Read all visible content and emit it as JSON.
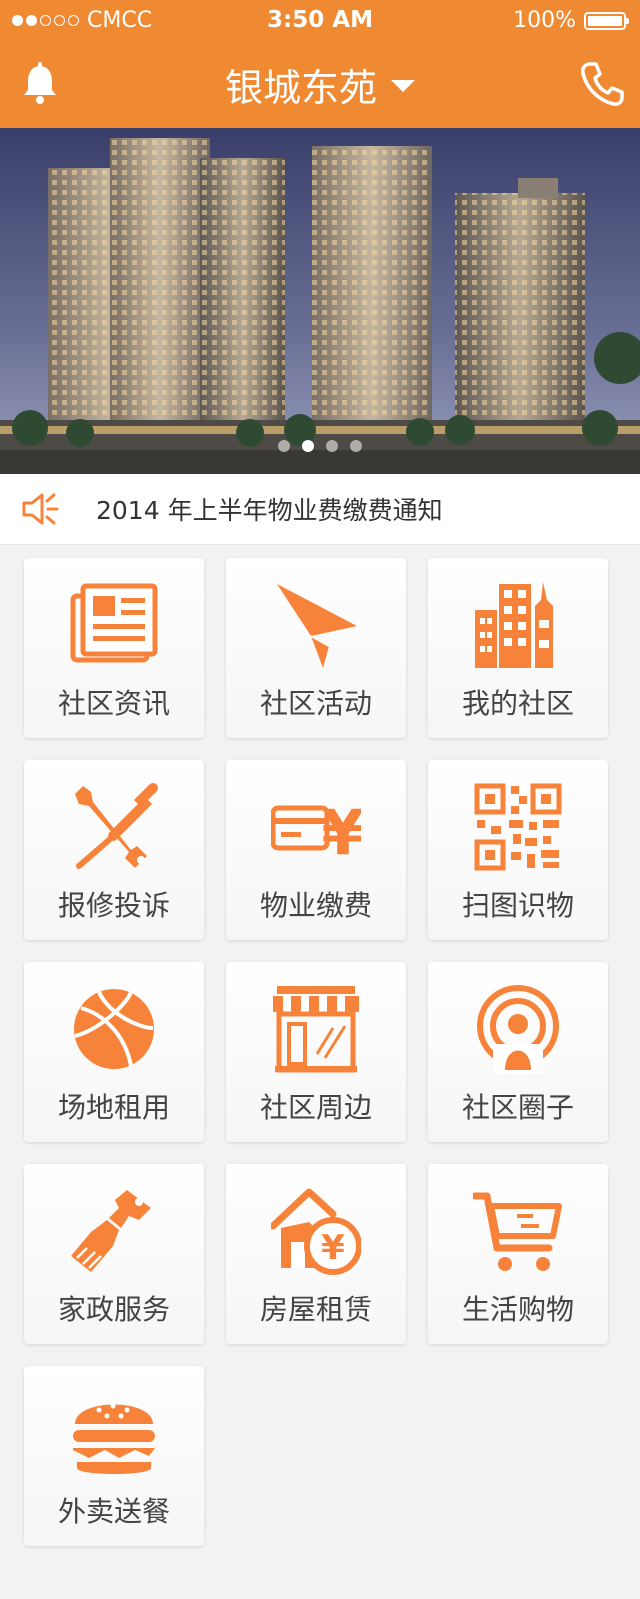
{
  "status": {
    "carrier": "CMCC",
    "time": "3:50 AM",
    "battery": "100%"
  },
  "nav": {
    "title": "银城东苑",
    "left_icon": "bell-icon",
    "right_icon": "phone-icon"
  },
  "notice": {
    "icon": "speaker-icon",
    "text": "2014 年上半年物业费缴费通知"
  },
  "theme": {
    "accent": "#f08a32",
    "icon": "#f7833a"
  },
  "tiles": [
    {
      "label": "社区资讯",
      "icon": "newspaper-icon"
    },
    {
      "label": "社区活动",
      "icon": "paper-plane-icon"
    },
    {
      "label": "我的社区",
      "icon": "buildings-icon"
    },
    {
      "label": "报修投诉",
      "icon": "tools-icon"
    },
    {
      "label": "物业缴费",
      "icon": "card-yuan-icon"
    },
    {
      "label": "扫图识物",
      "icon": "qr-code-icon"
    },
    {
      "label": "场地租用",
      "icon": "ball-icon"
    },
    {
      "label": "社区周边",
      "icon": "storefront-icon"
    },
    {
      "label": "社区圈子",
      "icon": "broadcast-user-icon"
    },
    {
      "label": "家政服务",
      "icon": "brush-icon"
    },
    {
      "label": "房屋租赁",
      "icon": "house-yuan-icon"
    },
    {
      "label": "生活购物",
      "icon": "cart-icon"
    },
    {
      "label": "外卖送餐",
      "icon": "burger-icon"
    }
  ]
}
